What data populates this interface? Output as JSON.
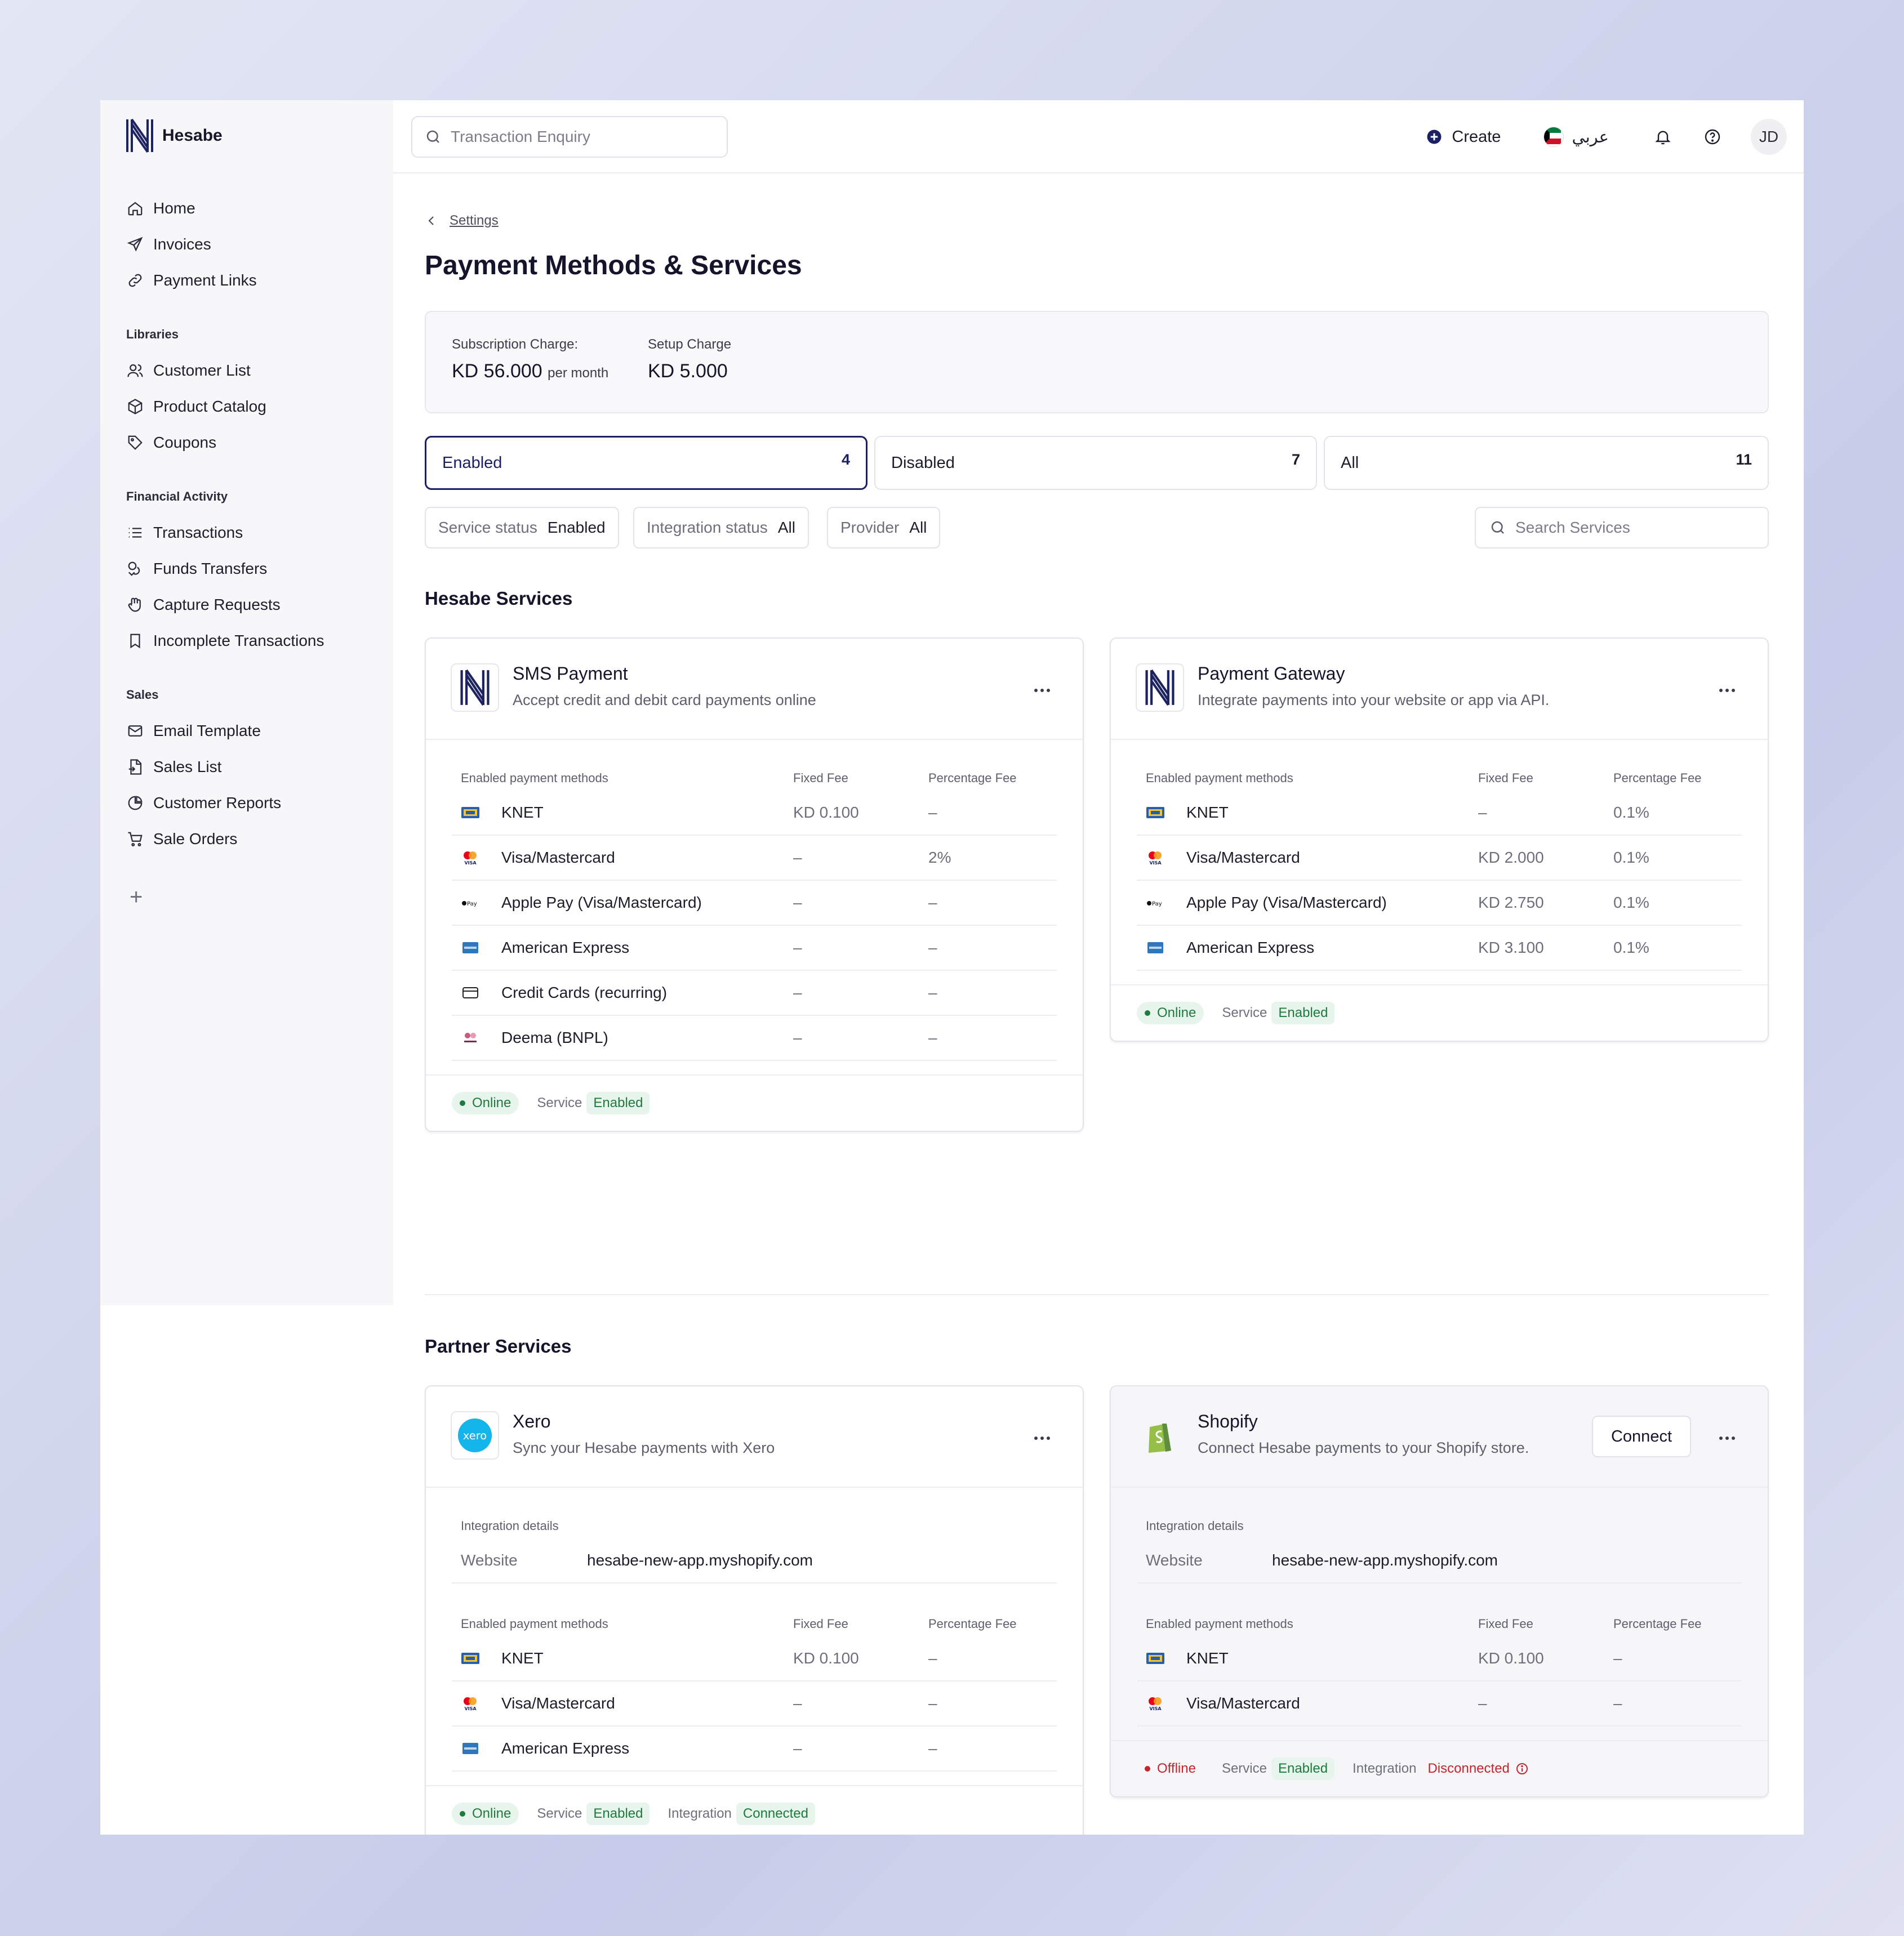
{
  "app": {
    "name": "Hesabe"
  },
  "sidebar": {
    "primary": [
      {
        "label": "Home",
        "icon": "home-icon"
      },
      {
        "label": "Invoices",
        "icon": "send-icon"
      },
      {
        "label": "Payment Links",
        "icon": "link-icon"
      }
    ],
    "libraries_title": "Libraries",
    "libraries": [
      {
        "label": "Customer List",
        "icon": "users-icon"
      },
      {
        "label": "Product Catalog",
        "icon": "box-icon"
      },
      {
        "label": "Coupons",
        "icon": "tag-icon"
      }
    ],
    "financial_title": "Financial Activity",
    "financial": [
      {
        "label": "Transactions",
        "icon": "list-icon"
      },
      {
        "label": "Funds Transfers",
        "icon": "coins-icon"
      },
      {
        "label": "Capture Requests",
        "icon": "hand-icon"
      },
      {
        "label": "Incomplete Transactions",
        "icon": "bookmark-icon"
      }
    ],
    "sales_title": "Sales",
    "sales": [
      {
        "label": "Email Template",
        "icon": "mail-icon"
      },
      {
        "label": "Sales List",
        "icon": "file-icon"
      },
      {
        "label": "Customer Reports",
        "icon": "pie-icon"
      },
      {
        "label": "Sale Orders",
        "icon": "cart-icon"
      }
    ],
    "add_label": "+"
  },
  "topbar": {
    "search_placeholder": "Transaction Enquiry",
    "create_label": "Create",
    "language_label": "عربي",
    "avatar_initials": "JD"
  },
  "page": {
    "breadcrumb": "Settings",
    "title": "Payment Methods & Services",
    "subscription_label": "Subscription Charge:",
    "subscription_value": "KD 56.000",
    "subscription_period": "per month",
    "setup_label": "Setup Charge",
    "setup_value": "KD 5.000"
  },
  "segments": [
    {
      "label": "Enabled",
      "count": "4"
    },
    {
      "label": "Disabled",
      "count": "7"
    },
    {
      "label": "All",
      "count": "11"
    }
  ],
  "filters": [
    {
      "label": "Service status",
      "value": "Enabled"
    },
    {
      "label": "Integration status",
      "value": "All"
    },
    {
      "label": "Provider",
      "value": "All"
    }
  ],
  "service_search_placeholder": "Search Services",
  "sections": {
    "hesabe": "Hesabe Services",
    "partner": "Partner Services"
  },
  "table_headers": {
    "method": "Enabled payment methods",
    "fixed": "Fixed Fee",
    "percent": "Percentage Fee"
  },
  "integration": {
    "title": "Integration details",
    "website_label": "Website"
  },
  "footer_labels": {
    "service": "Service",
    "integration": "Integration"
  },
  "cards": {
    "sms": {
      "title": "SMS Payment",
      "subtitle": "Accept credit and debit card payments online",
      "rows": [
        {
          "name": "KNET",
          "fixed": "KD 0.100",
          "percent": "–"
        },
        {
          "name": "Visa/Mastercard",
          "fixed": "–",
          "percent": "2%"
        },
        {
          "name": "Apple Pay (Visa/Mastercard)",
          "fixed": "–",
          "percent": "–"
        },
        {
          "name": "American Express",
          "fixed": "–",
          "percent": "–"
        },
        {
          "name": "Credit Cards (recurring)",
          "fixed": "–",
          "percent": "–"
        },
        {
          "name": "Deema (BNPL)",
          "fixed": "–",
          "percent": "–"
        }
      ],
      "status": "Online",
      "service_status": "Enabled"
    },
    "gateway": {
      "title": "Payment Gateway",
      "subtitle": "Integrate payments into your website or app via API.",
      "rows": [
        {
          "name": "KNET",
          "fixed": "–",
          "percent": "0.1%"
        },
        {
          "name": "Visa/Mastercard",
          "fixed": "KD 2.000",
          "percent": "0.1%"
        },
        {
          "name": "Apple Pay (Visa/Mastercard)",
          "fixed": "KD 2.750",
          "percent": "0.1%"
        },
        {
          "name": "American Express",
          "fixed": "KD 3.100",
          "percent": "0.1%"
        }
      ],
      "status": "Online",
      "service_status": "Enabled"
    },
    "xero": {
      "title": "Xero",
      "subtitle": "Sync your Hesabe payments with Xero",
      "website": "hesabe-new-app.myshopify.com",
      "rows": [
        {
          "name": "KNET",
          "fixed": "KD 0.100",
          "percent": "–"
        },
        {
          "name": "Visa/Mastercard",
          "fixed": "–",
          "percent": "–"
        },
        {
          "name": "American Express",
          "fixed": "–",
          "percent": "–"
        }
      ],
      "status": "Online",
      "service_status": "Enabled",
      "integration_status": "Connected"
    },
    "shopify": {
      "title": "Shopify",
      "subtitle": "Connect Hesabe payments to your Shopify store.",
      "connect_label": "Connect",
      "website": "hesabe-new-app.myshopify.com",
      "rows": [
        {
          "name": "KNET",
          "fixed": "KD 0.100",
          "percent": "–"
        },
        {
          "name": "Visa/Mastercard",
          "fixed": "–",
          "percent": "–"
        }
      ],
      "status": "Offline",
      "service_status": "Enabled",
      "integration_status": "Disconnected"
    }
  },
  "colors": {
    "brand": "#1b1f63",
    "success": "#1f7a3e",
    "danger": "#c0262d"
  }
}
